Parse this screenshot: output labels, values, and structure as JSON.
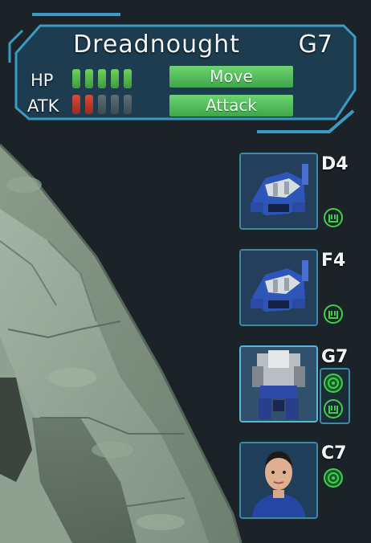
{
  "unit_panel": {
    "name": "Dreadnought",
    "position": "G7",
    "hp_label": "HP",
    "atk_label": "ATK",
    "hp": {
      "filled": 5,
      "total": 5,
      "color": "#5bc24f"
    },
    "atk": {
      "filled": 2,
      "total": 5,
      "color": "#c83a2c"
    },
    "move_label": "Move",
    "attack_label": "Attack"
  },
  "roster": [
    {
      "coord": "D4",
      "type": "mech",
      "status_icons": [
        "action-ready-icon"
      ]
    },
    {
      "coord": "F4",
      "type": "mech",
      "status_icons": [
        "action-ready-icon"
      ]
    },
    {
      "coord": "G7",
      "type": "dreadnought",
      "selected": true,
      "status_icons": [
        "move-ready-icon",
        "action-ready-icon"
      ]
    },
    {
      "coord": "C7",
      "type": "pilot",
      "status_icons": [
        "move-ready-icon"
      ]
    }
  ],
  "colors": {
    "panel_bg": "#1d3f52",
    "panel_border": "#3b9bc4",
    "button_green": "#55c25e",
    "status_green": "#3fd04a",
    "background": "#1b2328"
  }
}
